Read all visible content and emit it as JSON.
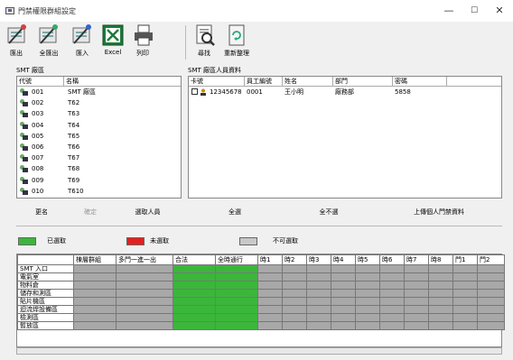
{
  "window": {
    "title": "門禁權限群組設定",
    "min": "—",
    "max": "☐",
    "close": "✕"
  },
  "toolbar": {
    "export": "匯出",
    "export_all": "全匯出",
    "import": "匯入",
    "excel": "Excel",
    "print": "列印",
    "find": "尋找",
    "reorganize": "重新整理"
  },
  "left_panel": {
    "title": "SMT 廠區",
    "col_code": "代號",
    "col_name": "名稱",
    "rows": [
      {
        "code": "001",
        "name": "SMT 廠區"
      },
      {
        "code": "002",
        "name": "T62"
      },
      {
        "code": "003",
        "name": "T63"
      },
      {
        "code": "004",
        "name": "T64"
      },
      {
        "code": "005",
        "name": "T65"
      },
      {
        "code": "006",
        "name": "T66"
      },
      {
        "code": "007",
        "name": "T67"
      },
      {
        "code": "008",
        "name": "T68"
      },
      {
        "code": "009",
        "name": "T69"
      },
      {
        "code": "010",
        "name": "T610"
      }
    ],
    "btn_rename": "更名",
    "btn_confirm": "確定",
    "btn_select": "選取人員"
  },
  "right_panel": {
    "title": "SMT 廠區人員資料",
    "cols": [
      "卡號",
      "員工編號",
      "姓名",
      "部門",
      "密碼"
    ],
    "rows": [
      {
        "card": "12345678",
        "emp": "0001",
        "name": "王小明",
        "dept": "廠務部",
        "pwd": "5858"
      }
    ],
    "btn_all": "全選",
    "btn_none": "全不選",
    "btn_upload": "上傳個人門禁資料"
  },
  "legend": {
    "selected": "已選取",
    "unselected": "未選取",
    "unavailable": "不可選取",
    "colors": {
      "selected": "#3bb63b",
      "unselected": "#e32020",
      "unavailable": "#c8c8c8"
    }
  },
  "access": {
    "headers": [
      "",
      "棟層群組",
      "多門一進一出",
      "合法",
      "全時通行",
      "時1",
      "時2",
      "時3",
      "時4",
      "時5",
      "時6",
      "時7",
      "時8",
      "門1",
      "門2"
    ],
    "rows": [
      "SMT 入口",
      "電氣室",
      "物料倉",
      "儲存和測區",
      "貼片機區",
      "迴流焊設備區",
      "檢測區",
      "暫放區"
    ]
  }
}
